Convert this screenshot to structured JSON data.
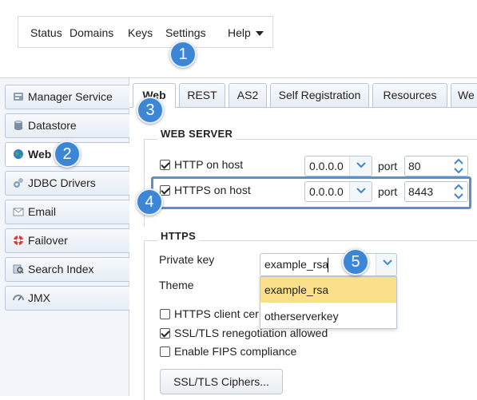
{
  "menu": {
    "status": "Status",
    "domains": "Domains",
    "keys": "Keys",
    "settings": "Settings",
    "help": "Help"
  },
  "badges": [
    "1",
    "2",
    "3",
    "4",
    "5"
  ],
  "sidebar": {
    "items": [
      {
        "label": "Manager Service",
        "icon": "manager-service-icon"
      },
      {
        "label": "Datastore",
        "icon": "datastore-icon"
      },
      {
        "label": "Web",
        "icon": "globe-icon",
        "active": true
      },
      {
        "label": "JDBC Drivers",
        "icon": "jdbc-drivers-icon"
      },
      {
        "label": "Email",
        "icon": "envelope-icon"
      },
      {
        "label": "Failover",
        "icon": "lifebuoy-icon"
      },
      {
        "label": "Search Index",
        "icon": "search-index-icon"
      },
      {
        "label": "JMX",
        "icon": "gauge-icon"
      }
    ]
  },
  "tabs": [
    "Web",
    "REST",
    "AS2",
    "Self Registration",
    "Resources",
    "We"
  ],
  "web_server": {
    "legend": "WEB SERVER",
    "http": {
      "label": "HTTP on host",
      "checked": true,
      "host": "0.0.0.0",
      "port_label": "port",
      "port": "80"
    },
    "https": {
      "label": "HTTPS on host",
      "checked": true,
      "host": "0.0.0.0",
      "port_label": "port",
      "port": "8443"
    }
  },
  "https": {
    "legend": "HTTPS",
    "private_key_label": "Private key",
    "private_key_value": "example_rsa",
    "theme_label": "Theme",
    "key_options": [
      "example_rsa",
      "otherserverkey"
    ],
    "client_cert_label": "HTTPS client cer",
    "client_cert_checked": false,
    "ssl_reneg_label": "SSL/TLS renegotiation allowed",
    "ssl_reneg_checked": true,
    "fips_label": "Enable FIPS compliance",
    "fips_checked": false
  },
  "ciphers_button": "SSL/TLS Ciphers...",
  "colors": {
    "accent": "#3d86d6",
    "highlight_border": "#5c8fd0",
    "selected_option": "#fbe08c"
  }
}
